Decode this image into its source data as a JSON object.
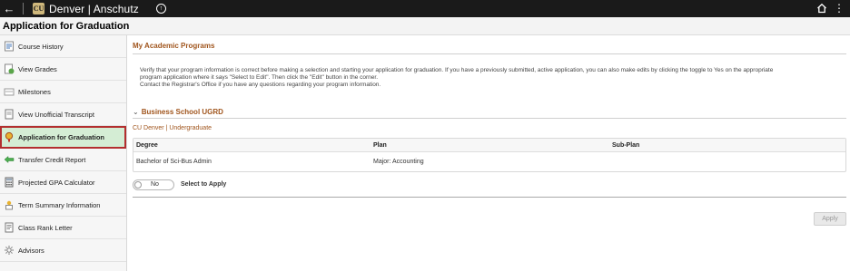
{
  "topbar": {
    "brand": "Denver | Anschutz",
    "logo_text": "CU",
    "back_icon": "arrow-left-icon",
    "help_icon": "help-icon",
    "home_icon": "home-icon",
    "more_icon": "more-vertical-icon"
  },
  "page": {
    "title": "Application for Graduation"
  },
  "sidebar": {
    "items": [
      {
        "label": "Course History",
        "icon": "document-list-icon"
      },
      {
        "label": "View Grades",
        "icon": "grades-icon"
      },
      {
        "label": "Milestones",
        "icon": "milestones-icon"
      },
      {
        "label": "View Unofficial Transcript",
        "icon": "transcript-icon"
      },
      {
        "label": "Application for Graduation",
        "icon": "graduation-icon",
        "active": true
      },
      {
        "label": "Transfer Credit Report",
        "icon": "arrow-transfer-icon"
      },
      {
        "label": "Projected GPA Calculator",
        "icon": "calculator-icon"
      },
      {
        "label": "Term Summary Information",
        "icon": "term-summary-icon"
      },
      {
        "label": "Class Rank Letter",
        "icon": "letter-icon"
      },
      {
        "label": "Advisors",
        "icon": "advisors-icon"
      }
    ]
  },
  "main": {
    "section_title": "My Academic Programs",
    "instructions": [
      "Verify that your program information is correct before making a selection and starting your application for graduation. If you have a previously submitted, active application, you can also make edits by clicking the toggle to Yes on the appropriate",
      "program application where it says \"Select to Edit\". Then click the \"Edit\" button in the corner.",
      "Contact the Registrar's Office if you have any questions regarding your program information."
    ],
    "school_title": "Business School UGRD",
    "career": "CU Denver | Undergraduate",
    "table": {
      "headers": [
        "Degree",
        "Plan",
        "Sub-Plan"
      ],
      "rows": [
        [
          "Bachelor of Sci-Bus Admin",
          "Major: Accounting",
          ""
        ]
      ]
    },
    "toggle": {
      "value": "No",
      "label": "Select to Apply"
    },
    "apply_label": "Apply"
  },
  "colors": {
    "topbar_bg": "#1a1a1a",
    "accent": "#a0551d",
    "active_bg": "#d4edd4",
    "active_border": "#b32f2f",
    "logo_gold": "#cfb87c"
  }
}
